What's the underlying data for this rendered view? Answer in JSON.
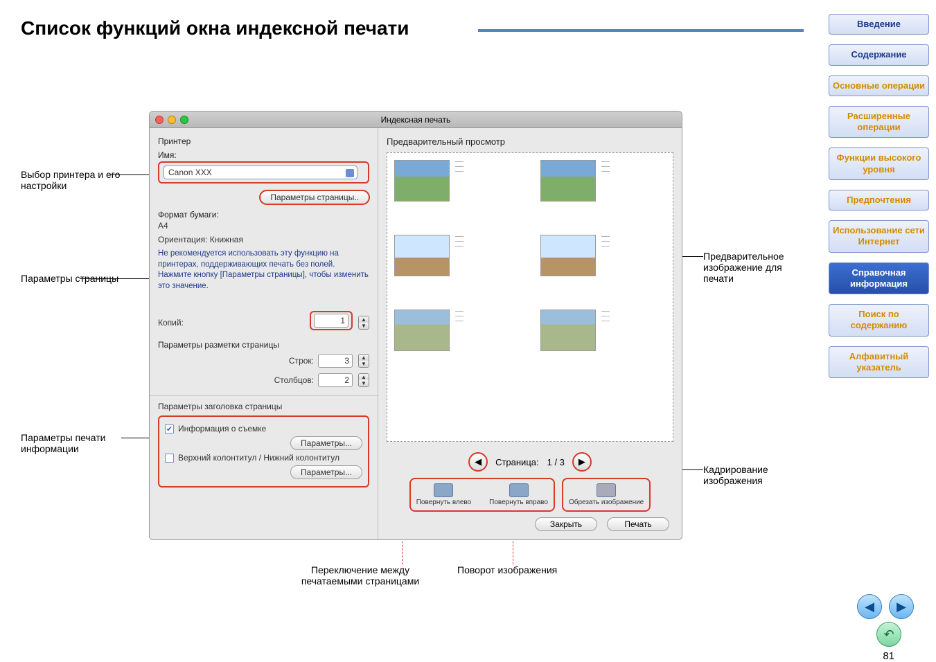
{
  "page": {
    "title": "Список функций окна индексной печати",
    "number": "81"
  },
  "sidebar": {
    "items": [
      {
        "label": "Введение"
      },
      {
        "label": "Содержание"
      },
      {
        "label": "Основные операции"
      },
      {
        "label": "Расширенные операции"
      },
      {
        "label": "Функции высокого уровня"
      },
      {
        "label": "Предпочтения"
      },
      {
        "label": "Использование сети Интернет"
      },
      {
        "label": "Справочная информация",
        "active": true
      },
      {
        "label": "Поиск по содержанию"
      },
      {
        "label": "Алфавитный указатель"
      }
    ]
  },
  "callouts": {
    "printer_select": "Выбор принтера и его настройки",
    "page_params": "Параметры страницы",
    "print_info_params": "Параметры печати информации",
    "page_switch": "Переключение между печатаемыми страницами",
    "rotate_image": "Поворот изображения",
    "preview_image": "Предварительное изображение для печати",
    "trimming": "Кадрирование изображения"
  },
  "dialog": {
    "window_title": "Индексная печать",
    "left": {
      "printer_label": "Принтер",
      "name_label": "Имя:",
      "printer_value": "Canon XXX",
      "page_setup_btn": "Параметры страницы..",
      "paper_label": "Формат бумаги:",
      "paper_value": "A4",
      "orientation_label": "Ориентация:  Книжная",
      "margin_note": "Не рекомендуется использовать эту функцию на принтерах, поддерживающих печать без полей. Нажмите кнопку [Параметры страницы], чтобы изменить это значение.",
      "copies_label": "Копий:",
      "copies_value": "1",
      "layout_label": "Параметры разметки страницы",
      "rows_label": "Строк:",
      "rows_value": "3",
      "cols_label": "Столбцов:",
      "cols_value": "2",
      "header_section": "Параметры заголовка страницы",
      "shooting_info_label": "Информация о съемке",
      "shooting_info_checked": true,
      "params_btn": "Параметры...",
      "header_footer_label": "Верхний колонтитул / Нижний колонтитул",
      "header_footer_checked": false,
      "params_btn2": "Параметры..."
    },
    "right": {
      "preview_label": "Предварительный просмотр",
      "page_indicator_prefix": "Страница:",
      "page_indicator_value": "1 / 3",
      "tool_rotate_left": "Повернуть влево",
      "tool_rotate_right": "Повернуть вправо",
      "tool_crop": "Обрезать изображение",
      "close_btn": "Закрыть",
      "print_btn": "Печать"
    }
  }
}
